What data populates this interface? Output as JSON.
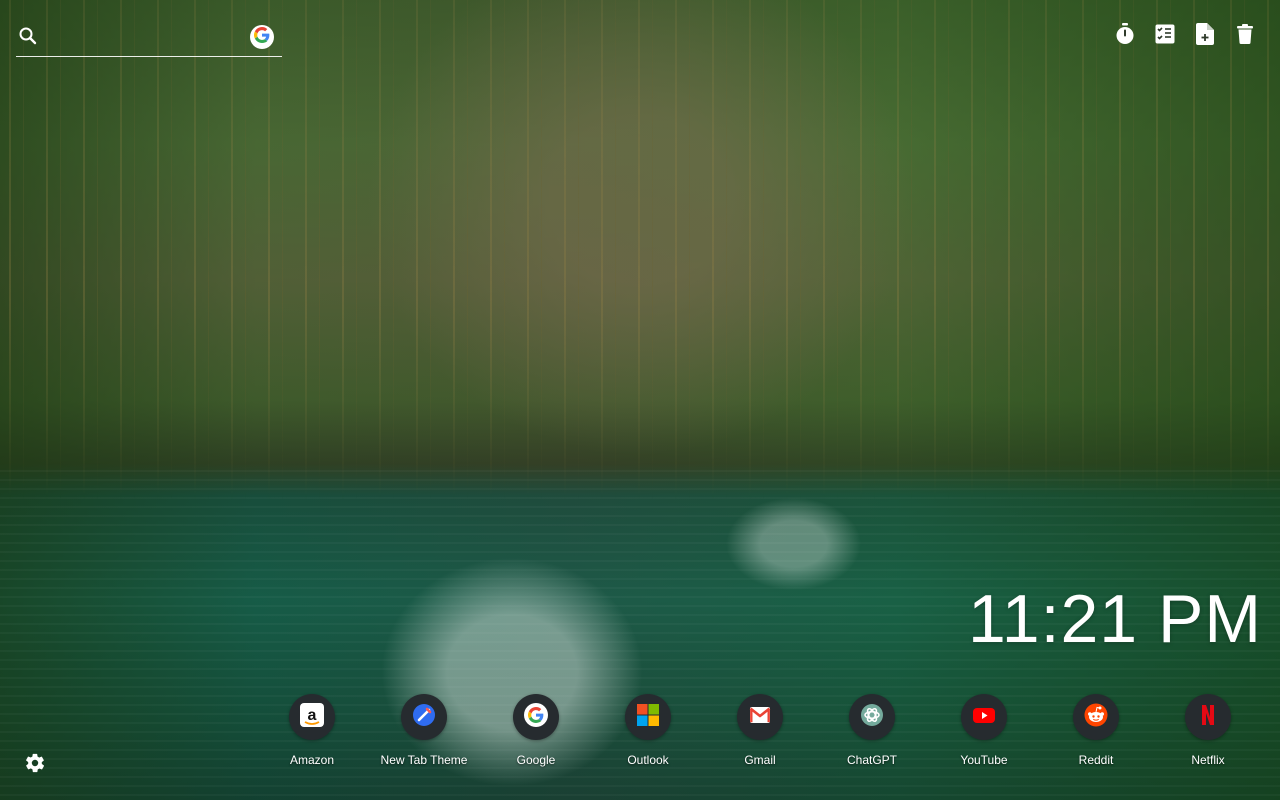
{
  "search": {
    "placeholder": "",
    "engine_icon": "google-icon"
  },
  "toolbar": [
    {
      "icon": "timer-icon"
    },
    {
      "icon": "todo-list-icon"
    },
    {
      "icon": "notes-icon"
    },
    {
      "icon": "trash-icon"
    }
  ],
  "clock": {
    "time": "11:21 PM"
  },
  "shortcuts": [
    {
      "label": "Amazon",
      "icon": "amazon-icon"
    },
    {
      "label": "New Tab Theme",
      "icon": "new-tab-theme-icon"
    },
    {
      "label": "Google",
      "icon": "google-icon"
    },
    {
      "label": "Outlook",
      "icon": "outlook-icon"
    },
    {
      "label": "Gmail",
      "icon": "gmail-icon"
    },
    {
      "label": "ChatGPT",
      "icon": "chatgpt-icon"
    },
    {
      "label": "YouTube",
      "icon": "youtube-icon"
    },
    {
      "label": "Reddit",
      "icon": "reddit-icon"
    },
    {
      "label": "Netflix",
      "icon": "netflix-icon"
    }
  ],
  "settings": {
    "icon": "gear-icon"
  },
  "colors": {
    "shortcut_bubble": "#262b2f",
    "text": "#ffffff"
  }
}
